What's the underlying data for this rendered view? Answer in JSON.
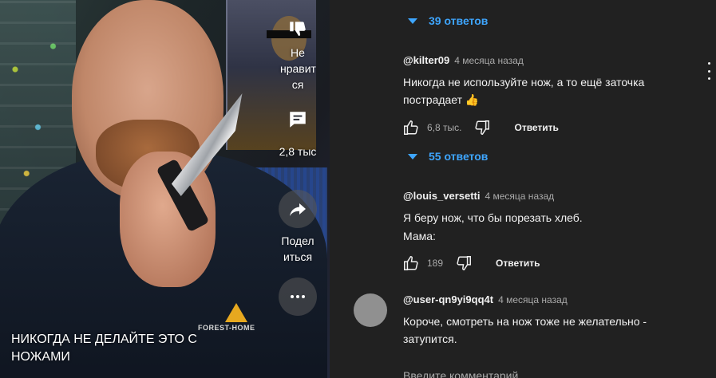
{
  "video": {
    "title": "НИКОГДА НЕ ДЕЛАЙТЕ ЭТО С НОЖАМИ",
    "brand_logo_text": "FOREST-HOME",
    "actions": {
      "dislike_label": "Не нравит ся",
      "comments_label": "2,8 тыс",
      "share_label": "Подел иться"
    }
  },
  "comments": {
    "threads": [
      {
        "replies_toggle": "39 ответов"
      },
      {
        "author": "@kilter09",
        "time": "4 месяца назад",
        "text": "Никогда не используйте нож, а то ещё заточка пострадает 👍",
        "likes": "6,8 тыс.",
        "reply_label": "Ответить",
        "replies_toggle": "55 ответов"
      },
      {
        "author": "@louis_versetti",
        "time": "4 месяца назад",
        "text_line1": "Я беру нож, что бы порезать хлеб.",
        "text_line2": "Мама:",
        "likes": "189",
        "reply_label": "Ответить"
      },
      {
        "author": "@user-qn9yi9qq4t",
        "time": "4 месяца назад",
        "text": "Короче, смотреть на нож тоже не желательно - затупится."
      }
    ],
    "add_comment_placeholder": "Введите комментарий"
  },
  "colors": {
    "background": "#212121",
    "link_blue": "#3ea6ff",
    "secondary_text": "#aaaaaa",
    "avatar_gray": "#909090"
  },
  "icons": [
    "dislike-icon",
    "comment-icon",
    "share-icon",
    "more-icon",
    "thumb-up-icon",
    "thumb-down-icon",
    "chevron-down-icon",
    "kebab-menu-icon"
  ]
}
